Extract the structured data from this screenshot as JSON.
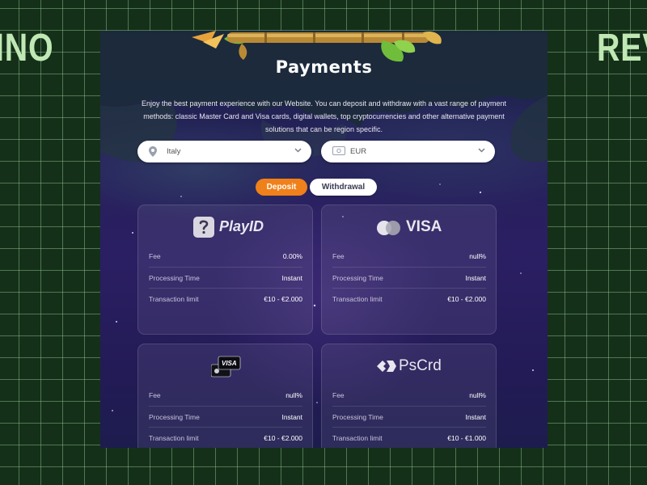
{
  "background_words": {
    "left": "INO",
    "right": "REV"
  },
  "page": {
    "title": "Payments",
    "description": "Enjoy the best payment experience with our Website. You can deposit and withdraw with a vast range of payment methods: classic Master Card and Visa cards, digital wallets, top cryptocurrencies and other alternative payment solutions that can be region specific."
  },
  "filters": {
    "country": {
      "value": "Italy",
      "icon": "location-pin-icon"
    },
    "currency": {
      "value": "EUR",
      "icon": "banknote-icon"
    }
  },
  "tabs": {
    "deposit": "Deposit",
    "withdrawal": "Withdrawal",
    "active": "deposit"
  },
  "labels": {
    "fee": "Fee",
    "processing_time": "Processing Time",
    "transaction_limit": "Transaction limit"
  },
  "methods": [
    {
      "logo_text": "PlayID",
      "icon": "playid-logo-icon",
      "fee": "0.00%",
      "processing_time": "Instant",
      "transaction_limit": "€10 - €2.000"
    },
    {
      "logo_text": "VISA",
      "icon": "mastercard-visa-logo-icon",
      "fee": "null%",
      "processing_time": "Instant",
      "transaction_limit": "€10 - €2.000"
    },
    {
      "logo_text": "VISA",
      "icon": "card-stack-visa-icon",
      "fee": "null%",
      "processing_time": "Instant",
      "transaction_limit": "€10 - €2.000"
    },
    {
      "logo_text": "PsCrd",
      "icon": "pscrd-logo-icon",
      "fee": "null%",
      "processing_time": "Instant",
      "transaction_limit": "€10 - €1.000"
    }
  ],
  "colors": {
    "accent": "#f08019",
    "background_grid": "#153019",
    "panel": "#25205a"
  }
}
